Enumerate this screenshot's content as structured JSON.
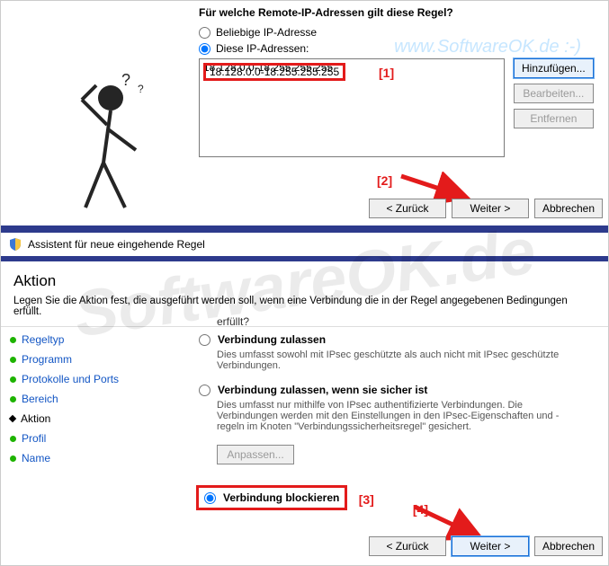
{
  "watermark": "SoftwareOK.de",
  "url_mark": "www.SoftwareOK.de :-)",
  "top": {
    "question": "Für welche Remote-IP-Adressen gilt diese Regel?",
    "radio_any": "Beliebige IP-Adresse",
    "radio_these": "Diese IP-Adressen:",
    "ip_range": "18.128.0.0-18.255.255.255",
    "btn_add": "Hinzufügen...",
    "btn_edit": "Bearbeiten...",
    "btn_remove": "Entfernen",
    "btn_back": "< Zurück",
    "btn_next": "Weiter >",
    "btn_cancel": "Abbrechen",
    "marker1": "[1]",
    "marker2": "[2]"
  },
  "titlebar": "Assistent für neue eingehende Regel",
  "bottom": {
    "headline": "Aktion",
    "sub": "Legen Sie die Aktion fest, die ausgeführt werden soll, wenn eine Verbindung die in der Regel angegebenen Bedingungen erfüllt.",
    "trailing": "erfüllt?",
    "steps": {
      "regeltyp": "Regeltyp",
      "programm": "Programm",
      "protokolle": "Protokolle und Ports",
      "bereich": "Bereich",
      "aktion": "Aktion",
      "profil": "Profil",
      "name": "Name"
    },
    "opt_allow_label": "Verbindung zulassen",
    "opt_allow_desc": "Dies umfasst sowohl mit IPsec geschützte als auch nicht mit IPsec geschützte Verbindungen.",
    "opt_secure_label": "Verbindung zulassen, wenn sie sicher ist",
    "opt_secure_desc": "Dies umfasst nur mithilfe von IPsec authentifizierte Verbindungen. Die Verbindungen werden mit den Einstellungen in den IPsec-Eigenschaften und -regeln im Knoten \"Verbindungssicherheitsregel\" gesichert.",
    "btn_customize": "Anpassen...",
    "opt_block_label": "Verbindung blockieren",
    "btn_back": "< Zurück",
    "btn_next": "Weiter >",
    "btn_cancel": "Abbrechen",
    "marker3": "[3]",
    "marker4": "[4]"
  }
}
